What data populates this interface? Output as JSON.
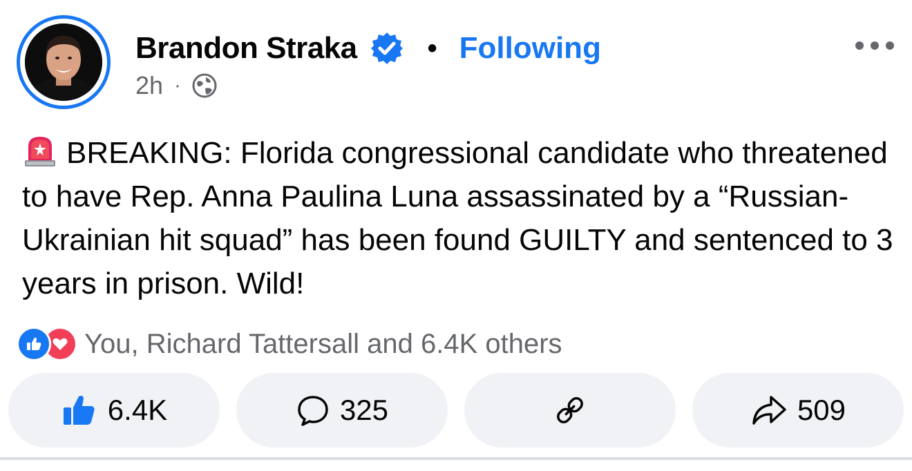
{
  "post": {
    "author_name": "Brandon Straka",
    "separator_dot": "•",
    "follow_status": "Following",
    "time_ago": "2h",
    "meta_dot": "·",
    "privacy_icon": "globe-icon",
    "verified_icon": "verified-badge-icon",
    "text": "BREAKING: Florida congressional candidate who threatened to have Rep. Anna Paulina Luna assassinated by a “Russian-Ukrainian hit squad” has been found GUILTY and sentenced to 3 years in prison. Wild!",
    "text_emoji_icon": "police-siren-icon"
  },
  "reactions": {
    "summary": "You, Richard Tattersall and 6.4K others",
    "types": [
      "like",
      "love"
    ]
  },
  "actions": {
    "like_count": "6.4K",
    "comment_count": "325",
    "share_count": "509"
  },
  "colors": {
    "accent": "#1877f2",
    "love": "#f33e58",
    "secondary_text": "#65676b",
    "button_bg": "#f0f2f5"
  }
}
